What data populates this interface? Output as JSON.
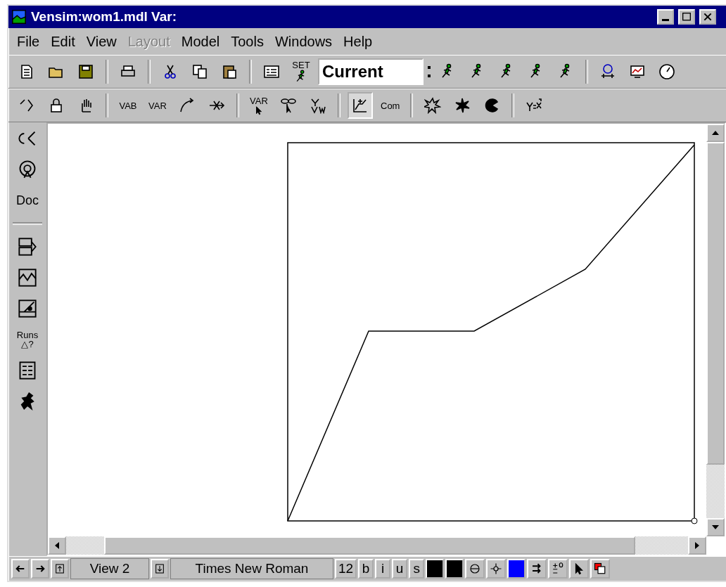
{
  "window": {
    "title": "Vensim:wom1.mdl Var:"
  },
  "menu": [
    {
      "label": "File",
      "disabled": false
    },
    {
      "label": "Edit",
      "disabled": false
    },
    {
      "label": "View",
      "disabled": false
    },
    {
      "label": "Layout",
      "disabled": true
    },
    {
      "label": "Model",
      "disabled": false
    },
    {
      "label": "Tools",
      "disabled": false
    },
    {
      "label": "Windows",
      "disabled": false
    },
    {
      "label": "Help",
      "disabled": false
    }
  ],
  "toolbar": {
    "set_label": "SET",
    "run_name": "Current"
  },
  "tools": [
    {
      "kind": "icon",
      "selected": false
    },
    {
      "kind": "icon",
      "selected": false
    },
    {
      "kind": "icon",
      "selected": false
    },
    {
      "kind": "divider"
    },
    {
      "kind": "text",
      "label": "VAB",
      "selected": false
    },
    {
      "kind": "text",
      "label": "VAR",
      "selected": false
    },
    {
      "kind": "icon",
      "selected": false
    },
    {
      "kind": "icon",
      "selected": false
    },
    {
      "kind": "divider"
    },
    {
      "kind": "text",
      "label": "VAR",
      "selected": false
    },
    {
      "kind": "icon",
      "selected": false
    },
    {
      "kind": "icon",
      "selected": false
    },
    {
      "kind": "divider"
    },
    {
      "kind": "icon",
      "selected": true
    },
    {
      "kind": "text",
      "label": "Com",
      "selected": false
    },
    {
      "kind": "divider"
    },
    {
      "kind": "icon",
      "selected": false
    },
    {
      "kind": "icon",
      "selected": false
    },
    {
      "kind": "icon",
      "selected": false
    },
    {
      "kind": "divider"
    },
    {
      "kind": "icon",
      "selected": false
    }
  ],
  "analysis_tools": [
    {
      "kind": "icon"
    },
    {
      "kind": "icon"
    },
    {
      "kind": "text",
      "label": "Doc"
    },
    {
      "kind": "divider"
    },
    {
      "kind": "icon"
    },
    {
      "kind": "icon"
    },
    {
      "kind": "icon"
    },
    {
      "kind": "text",
      "label": "Runs",
      "sub": "△?"
    },
    {
      "kind": "icon"
    },
    {
      "kind": "icon"
    }
  ],
  "status_bar": {
    "view": "View 2",
    "font": "Times New Roman",
    "size": "12",
    "styles": [
      {
        "label": "b"
      },
      {
        "label": "i"
      },
      {
        "label": "u"
      },
      {
        "label": "s"
      }
    ],
    "swatches": [
      {
        "color": "#000000"
      },
      {
        "color": "#000000"
      },
      {
        "color": "#0000ff"
      }
    ]
  }
}
